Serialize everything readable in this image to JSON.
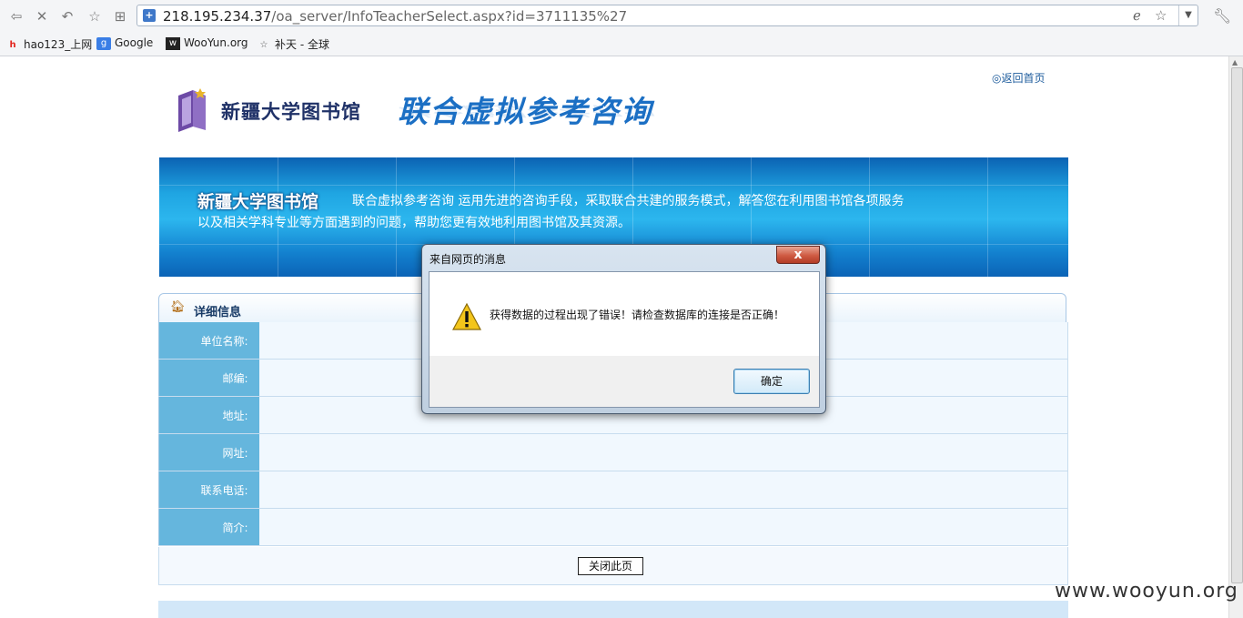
{
  "browser": {
    "url_host": "218.195.234.37",
    "url_path": "/oa_server/InfoTeacherSelect.aspx?id=3711135%27",
    "bookmarks": [
      {
        "label": "hao123_上网",
        "icon": "hao123-icon"
      },
      {
        "label": "Google",
        "icon": "google-icon"
      },
      {
        "label": "WooYun.org",
        "icon": "wooyun-icon"
      },
      {
        "label": "补天 - 全球",
        "icon": "butian-icon"
      }
    ]
  },
  "page": {
    "back_home": "◎返回首页",
    "library_name": "新疆大学图书馆",
    "service_title": "联合虚拟参考咨询",
    "banner": {
      "title": "新疆大学图书馆",
      "line1": "联合虚拟参考咨询  运用先进的咨询手段，采取联合共建的服务模式，解答您在利用图书馆各项服务",
      "line2": "以及相关学科专业等方面遇到的问题，帮助您更有效地利用图书馆及其资源。"
    },
    "detail": {
      "title": "详细信息",
      "fields": [
        {
          "label": "单位名称:",
          "value": ""
        },
        {
          "label": "邮编:",
          "value": ""
        },
        {
          "label": "地址:",
          "value": ""
        },
        {
          "label": "网址:",
          "value": ""
        },
        {
          "label": "联系电话:",
          "value": ""
        },
        {
          "label": "简介:",
          "value": ""
        }
      ],
      "close_button": "关闭此页"
    }
  },
  "dialog": {
    "title": "来自网页的消息",
    "message": "获得数据的过程出现了错误！请检查数据库的连接是否正确！",
    "ok_button": "确定",
    "close_symbol": "x"
  },
  "watermark": "www.wooyun.org",
  "colors": {
    "banner_blue": "#1fa5e2",
    "label_cell": "#65b6dd",
    "service_title": "#1b6fc4",
    "dialog_close": "#cf5a42"
  }
}
